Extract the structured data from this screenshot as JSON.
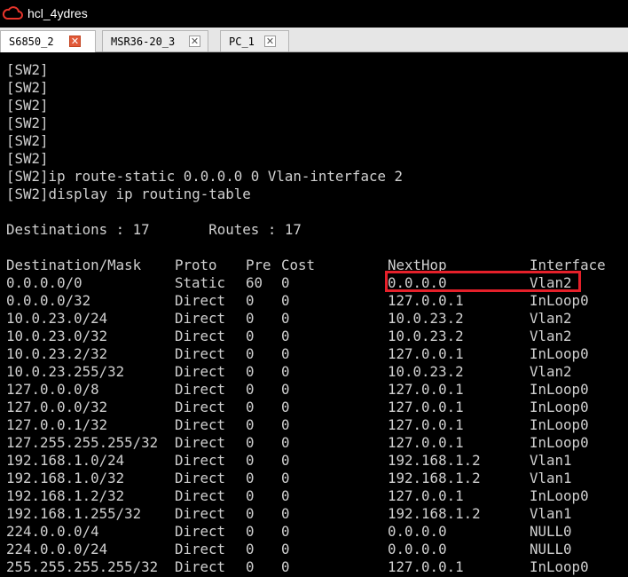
{
  "window": {
    "title": "hcl_4ydres",
    "app_icon": "cloud-icon"
  },
  "tabs": [
    {
      "label": "S6850_2",
      "active": true
    },
    {
      "label": "MSR36-20_3",
      "active": false
    },
    {
      "label": "PC_1",
      "active": false
    }
  ],
  "terminal": {
    "prompt_lines": [
      "[SW2]",
      "[SW2]",
      "[SW2]",
      "[SW2]",
      "[SW2]",
      "[SW2]",
      "[SW2]ip route-static 0.0.0.0 0 Vlan-interface 2",
      "[SW2]display ip routing-table"
    ],
    "summary": "Destinations : 17       Routes : 17",
    "table": {
      "headers": [
        "Destination/Mask",
        "Proto",
        "Pre",
        "Cost",
        "NextHop",
        "Interface"
      ],
      "rows": [
        [
          "0.0.0.0/0",
          "Static",
          "60",
          "0",
          "0.0.0.0",
          "Vlan2"
        ],
        [
          "0.0.0.0/32",
          "Direct",
          "0",
          "0",
          "127.0.0.1",
          "InLoop0"
        ],
        [
          "10.0.23.0/24",
          "Direct",
          "0",
          "0",
          "10.0.23.2",
          "Vlan2"
        ],
        [
          "10.0.23.0/32",
          "Direct",
          "0",
          "0",
          "10.0.23.2",
          "Vlan2"
        ],
        [
          "10.0.23.2/32",
          "Direct",
          "0",
          "0",
          "127.0.0.1",
          "InLoop0"
        ],
        [
          "10.0.23.255/32",
          "Direct",
          "0",
          "0",
          "10.0.23.2",
          "Vlan2"
        ],
        [
          "127.0.0.0/8",
          "Direct",
          "0",
          "0",
          "127.0.0.1",
          "InLoop0"
        ],
        [
          "127.0.0.0/32",
          "Direct",
          "0",
          "0",
          "127.0.0.1",
          "InLoop0"
        ],
        [
          "127.0.0.1/32",
          "Direct",
          "0",
          "0",
          "127.0.0.1",
          "InLoop0"
        ],
        [
          "127.255.255.255/32",
          "Direct",
          "0",
          "0",
          "127.0.0.1",
          "InLoop0"
        ],
        [
          "192.168.1.0/24",
          "Direct",
          "0",
          "0",
          "192.168.1.2",
          "Vlan1"
        ],
        [
          "192.168.1.0/32",
          "Direct",
          "0",
          "0",
          "192.168.1.2",
          "Vlan1"
        ],
        [
          "192.168.1.2/32",
          "Direct",
          "0",
          "0",
          "127.0.0.1",
          "InLoop0"
        ],
        [
          "192.168.1.255/32",
          "Direct",
          "0",
          "0",
          "192.168.1.2",
          "Vlan1"
        ],
        [
          "224.0.0.0/4",
          "Direct",
          "0",
          "0",
          "0.0.0.0",
          "NULL0"
        ],
        [
          "224.0.0.0/24",
          "Direct",
          "0",
          "0",
          "0.0.0.0",
          "NULL0"
        ],
        [
          "255.255.255.255/32",
          "Direct",
          "0",
          "0",
          "127.0.0.1",
          "InLoop0"
        ]
      ]
    },
    "highlight_color": "#e5202a",
    "text_color": "#d0d0d0",
    "background_color": "#000000"
  }
}
